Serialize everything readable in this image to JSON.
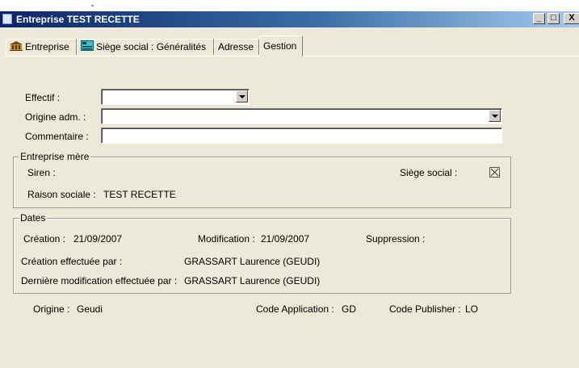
{
  "window": {
    "title": "Entreprise TEST RECETTE",
    "buttons": {
      "minimize": "_",
      "restore": "□",
      "close": "X"
    }
  },
  "tabs": [
    {
      "label": "Entreprise",
      "icon": "building-icon",
      "active": false
    },
    {
      "label": "Siège social : Généralités",
      "icon": "office-icon",
      "active": false
    },
    {
      "label": "Adresse",
      "active": false
    },
    {
      "label": "Gestion",
      "active": true
    }
  ],
  "form": {
    "effectif": {
      "label": "Effectif :",
      "value": ""
    },
    "origine_adm": {
      "label": "Origine adm. :",
      "value": ""
    },
    "commentaire": {
      "label": "Commentaire :",
      "value": ""
    }
  },
  "entreprise_mere": {
    "title": "Entreprise mère",
    "siren_label": "Siren :",
    "siren_value": "",
    "siege_label": "Siège social :",
    "siege_checked": true,
    "raison_label": "Raison sociale :",
    "raison_value": "TEST RECETTE"
  },
  "dates": {
    "title": "Dates",
    "creation_label": "Création :",
    "creation_value": "21/09/2007",
    "modification_label": "Modification :",
    "modification_value": "21/09/2007",
    "suppression_label": "Suppression :",
    "suppression_value": "",
    "created_by_label": "Création effectuée par :",
    "created_by_value": "GRASSART Laurence (GEUDI)",
    "modified_by_label": "Dernière modification effectuée par :",
    "modified_by_value": "GRASSART Laurence (GEUDI)"
  },
  "footer": {
    "origine_label": "Origine :",
    "origine_value": "Geudi",
    "code_app_label": "Code Application :",
    "code_app_value": "GD",
    "code_pub_label": "Code Publisher :",
    "code_pub_value": "LO"
  },
  "colors": {
    "titlebar_start": "#0a246a",
    "titlebar_end": "#a6caf0",
    "face": "#ece9d8"
  }
}
